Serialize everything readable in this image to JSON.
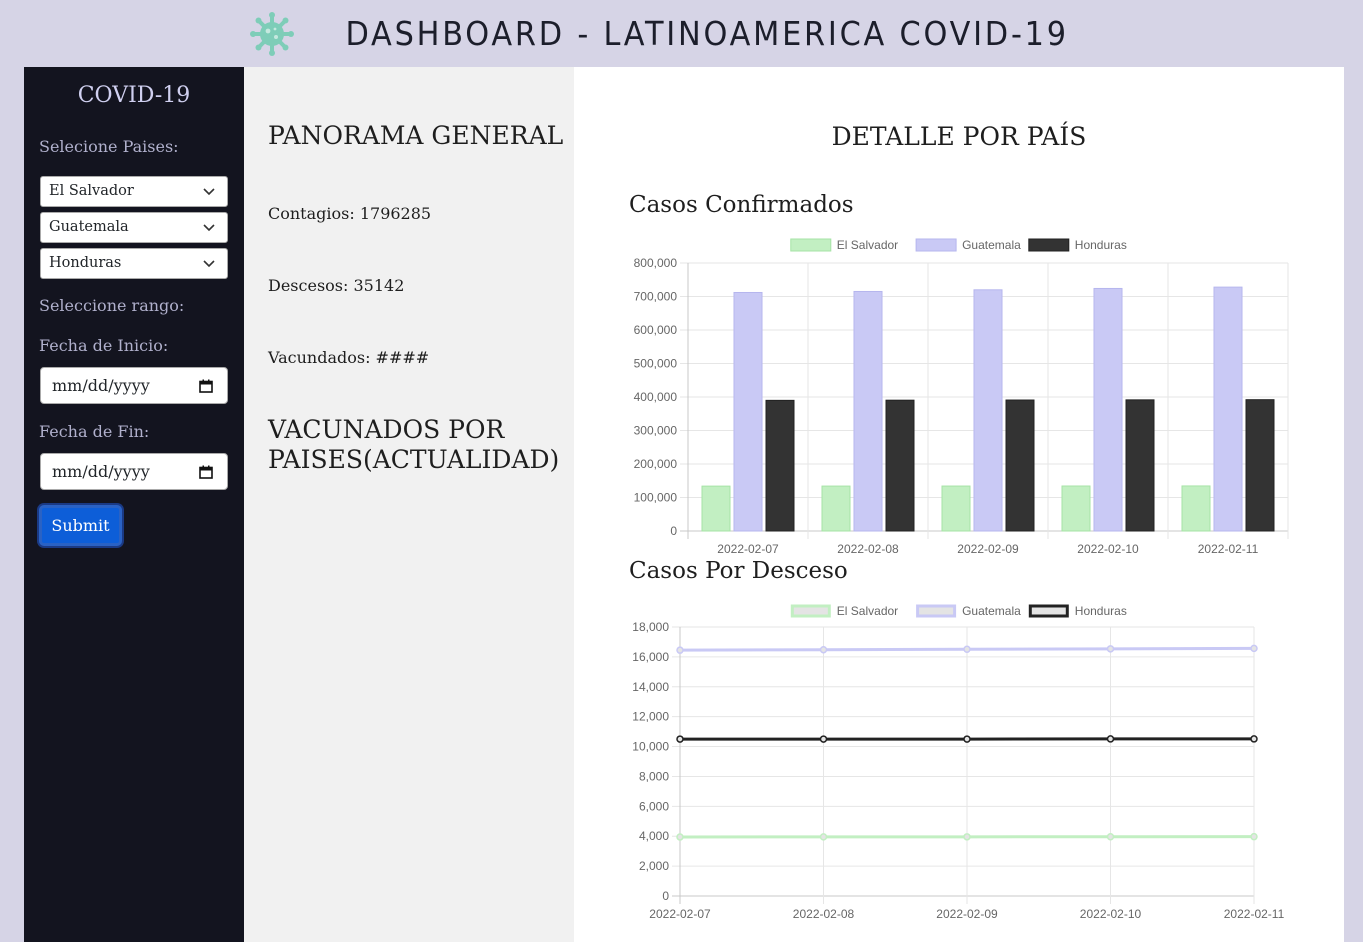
{
  "header": {
    "title": "DASHBOARD - LATINOAMERICA COVID-19",
    "logo_icon": "virus-icon",
    "logo_color": "#7ecdb8"
  },
  "sidebar": {
    "brand": "COVID-19",
    "countries_label": "Selecione Paises:",
    "countries": [
      "El Salvador",
      "Guatemala",
      "Honduras"
    ],
    "range_label": "Seleccione rango:",
    "start_label": "Fecha de Inicio:",
    "start_placeholder": "mm/dd/yyyy",
    "end_label": "Fecha de Fin:",
    "end_placeholder": "mm/dd/yyyy",
    "submit_label": "Submit"
  },
  "overview": {
    "title": "PANORAMA GENERAL",
    "contagios": "Contagios: 1796285",
    "descesos": "Descesos: 35142",
    "vacunados": "Vacundados: ####",
    "vaccinated_title": "VACUNADOS POR PAISES(ACTUALIDAD)"
  },
  "detail": {
    "title": "DETALLE POR PAÍS",
    "confirmed_title": "Casos Confirmados",
    "deaths_title": "Casos Por Desceso"
  },
  "chart_data": [
    {
      "type": "bar",
      "title": "Casos Confirmados",
      "categories": [
        "2022-02-07",
        "2022-02-08",
        "2022-02-09",
        "2022-02-10",
        "2022-02-11"
      ],
      "series": [
        {
          "name": "El Salvador",
          "color": "#c2efc2",
          "border": "#a6e3a6",
          "values": [
            134000,
            134100,
            134200,
            134300,
            134500
          ]
        },
        {
          "name": "Guatemala",
          "color": "#c9c9f5",
          "border": "#b6b6ee",
          "values": [
            712000,
            715000,
            720000,
            724000,
            728000
          ]
        },
        {
          "name": "Honduras",
          "color": "#333333",
          "border": "#222222",
          "values": [
            390000,
            390500,
            391000,
            391500,
            392000
          ]
        }
      ],
      "ylim": [
        0,
        800000
      ],
      "yticks": [
        0,
        100000,
        200000,
        300000,
        400000,
        500000,
        600000,
        700000,
        800000
      ],
      "legend": "top",
      "grid": true
    },
    {
      "type": "line",
      "title": "Casos Por Desceso",
      "categories": [
        "2022-02-07",
        "2022-02-08",
        "2022-02-09",
        "2022-02-10",
        "2022-02-11"
      ],
      "series": [
        {
          "name": "El Salvador",
          "color": "#c2efc2",
          "values": [
            3950,
            3955,
            3960,
            3965,
            3970
          ]
        },
        {
          "name": "Guatemala",
          "color": "#c9c9f5",
          "values": [
            16450,
            16480,
            16510,
            16540,
            16570
          ]
        },
        {
          "name": "Honduras",
          "color": "#222222",
          "values": [
            10500,
            10500,
            10500,
            10510,
            10510
          ]
        }
      ],
      "ylim": [
        0,
        18000
      ],
      "yticks": [
        0,
        2000,
        4000,
        6000,
        8000,
        10000,
        12000,
        14000,
        16000,
        18000
      ],
      "legend": "top",
      "grid": true
    }
  ]
}
